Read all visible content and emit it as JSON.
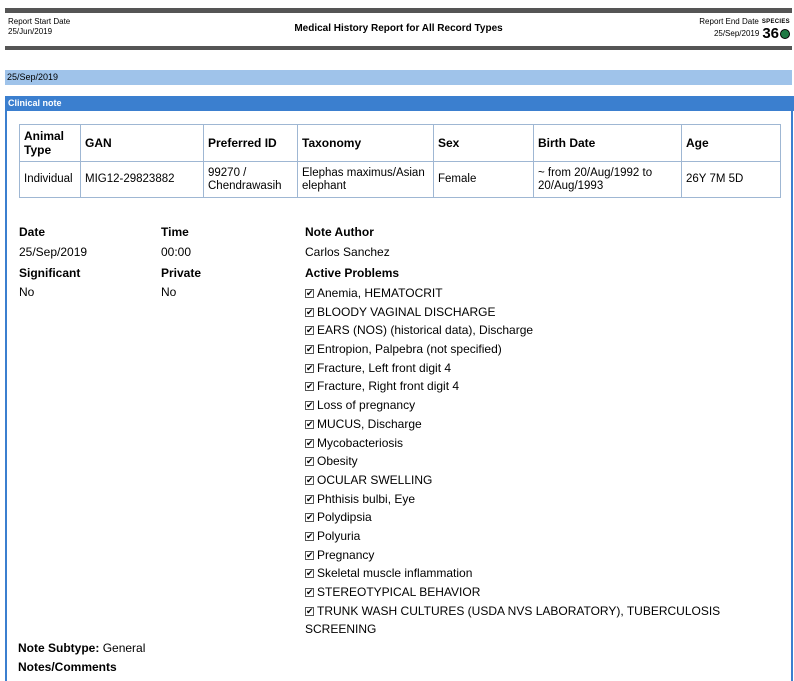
{
  "header": {
    "start_label": "Report Start Date",
    "start_date": "25/Jun/2019",
    "title": "Medical History Report for All Record Types",
    "end_label": "Report End Date",
    "end_date": "25/Sep/2019",
    "logo_word": "SPECIES",
    "logo_num": "36"
  },
  "date_bar": "25/Sep/2019",
  "section_label": "Clinical note",
  "animal_table": {
    "headers": [
      "Animal Type",
      "GAN",
      "Preferred ID",
      "Taxonomy",
      "Sex",
      "Birth Date",
      "Age"
    ],
    "row": [
      "Individual",
      "MIG12-29823882",
      "99270 / Chendrawasih",
      "Elephas maximus/Asian elephant",
      "Female",
      "~ from 20/Aug/1992 to 20/Aug/1993",
      "26Y 7M 5D"
    ]
  },
  "note": {
    "date_label": "Date",
    "date_value": "25/Sep/2019",
    "time_label": "Time",
    "time_value": "00:00",
    "author_label": "Note Author",
    "author_value": "Carlos Sanchez",
    "significant_label": "Significant",
    "significant_value": "No",
    "private_label": "Private",
    "private_value": "No",
    "problems_label": "Active Problems",
    "problems": [
      "Anemia, HEMATOCRIT",
      "BLOODY VAGINAL DISCHARGE",
      "EARS (NOS) (historical data), Discharge",
      "Entropion, Palpebra (not specified)",
      "Fracture, Left front digit 4",
      "Fracture, Right front digit 4",
      "Loss of pregnancy",
      "MUCUS, Discharge",
      "Mycobacteriosis",
      "Obesity",
      "OCULAR SWELLING",
      "Phthisis bulbi, Eye",
      "Polydipsia",
      "Polyuria",
      "Pregnancy",
      "Skeletal muscle inflammation",
      "STEREOTYPICAL BEHAVIOR",
      "TRUNK WASH CULTURES (USDA NVS LABORATORY), TUBERCULOSIS SCREENING"
    ],
    "subtype_label": "Note Subtype:",
    "subtype_value": "General",
    "comments_label": "Notes/Comments"
  }
}
